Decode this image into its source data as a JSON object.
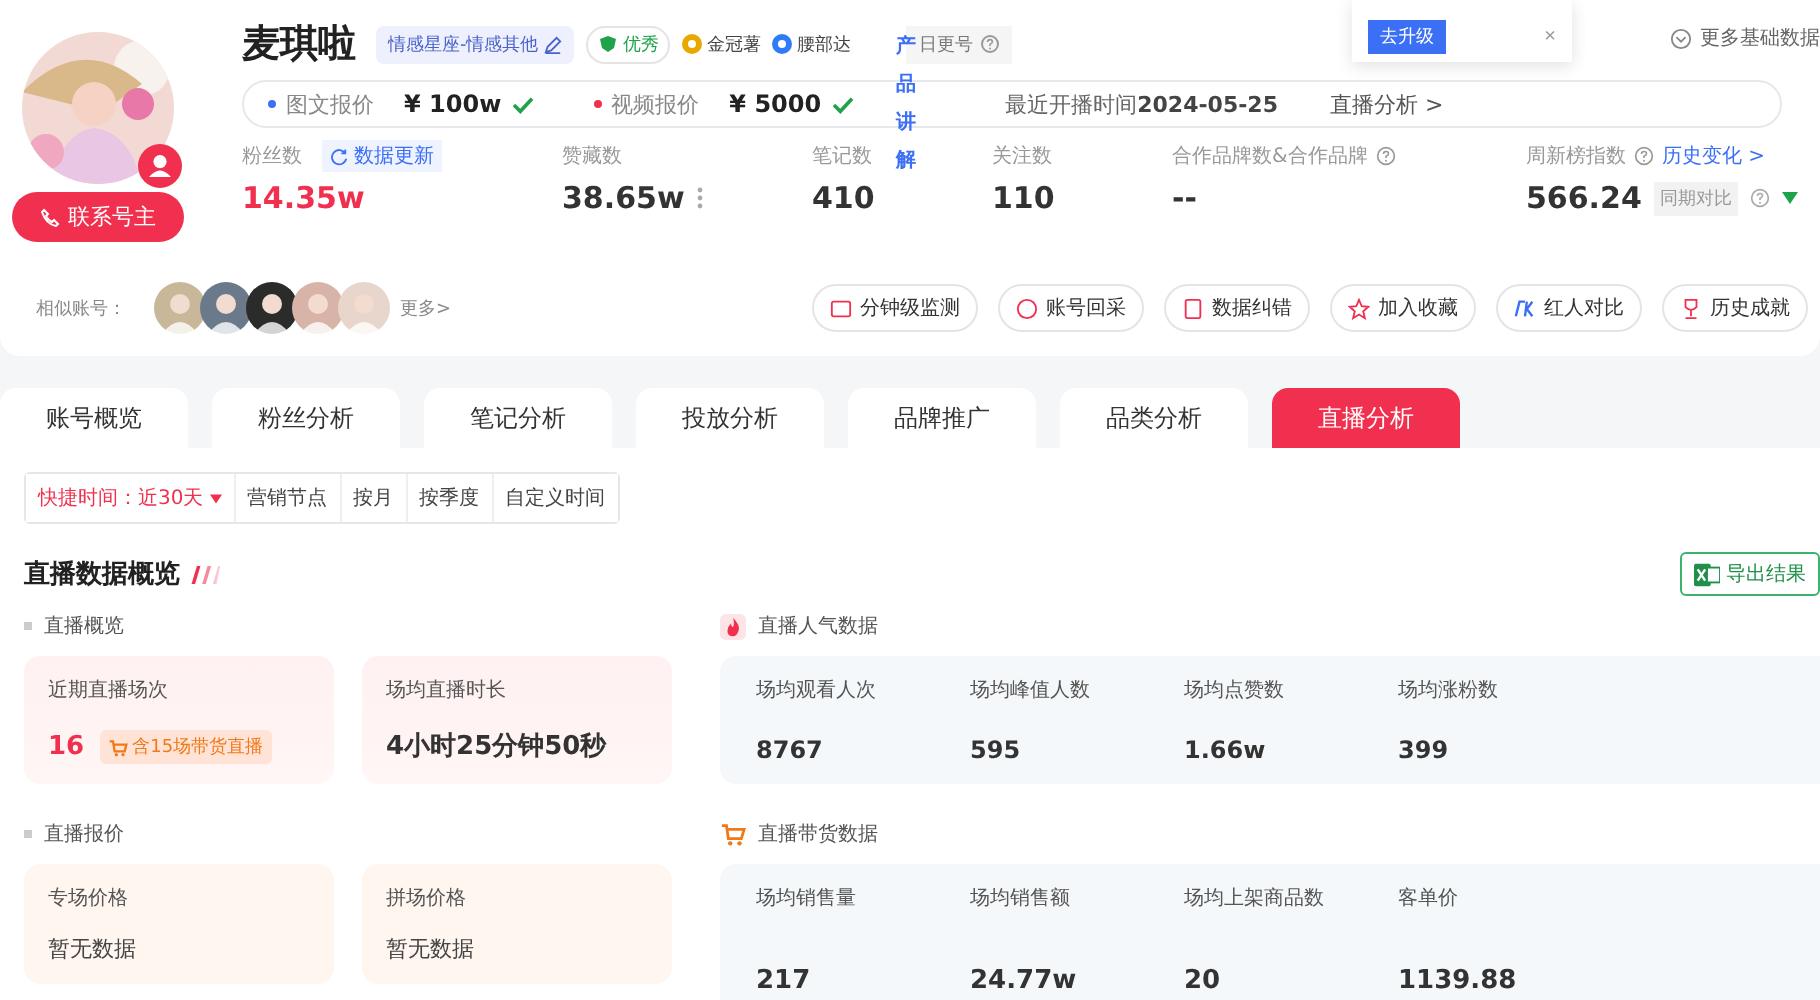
{
  "profile": {
    "name": "麦琪啦",
    "category": "情感星座-情感其他",
    "badges": [
      {
        "kind": "excellent",
        "label": "优秀"
      },
      {
        "kind": "crown",
        "label": "金冠薯"
      },
      {
        "kind": "brand",
        "label": "腰部达"
      },
      {
        "kind": "daily",
        "label": "日更号"
      }
    ],
    "contact_button": "联系号主",
    "prices": [
      {
        "label": "图文报价",
        "value": "¥ 100w",
        "verified": true,
        "color": "#3b6ff5"
      },
      {
        "label": "视频报价",
        "value": "¥ 5000",
        "verified": true,
        "color": "#f0304e"
      }
    ],
    "last_live_label": "最近开播时间",
    "last_live_date": "2024-05-25",
    "live_link": "直播分析 >",
    "side_label": "产品讲解",
    "popup": {
      "button": "去升级",
      "close": "×"
    },
    "more_data": "更多基础数据",
    "stats": [
      {
        "kind": "fans",
        "label": "粉丝数",
        "value": "14.35w",
        "link": "数据更新"
      },
      {
        "kind": "more",
        "label": "赞藏数",
        "value": "38.65w"
      },
      {
        "kind": "plain",
        "label": "笔记数",
        "value": "410"
      },
      {
        "kind": "plain",
        "label": "关注数",
        "value": "110"
      },
      {
        "kind": "help",
        "label": "合作品牌数&合作品牌",
        "value": "--"
      },
      {
        "kind": "index",
        "label": "周新榜指数",
        "value": "566.24",
        "link": "历史变化 >",
        "compare": "同期对比"
      }
    ]
  },
  "similar": {
    "label": "相似账号：",
    "more": "更多>",
    "actions": [
      {
        "kind": "monitor",
        "label": "分钟级监测"
      },
      {
        "kind": "collect",
        "label": "账号回采"
      },
      {
        "kind": "report",
        "label": "数据纠错"
      },
      {
        "kind": "favorite",
        "label": "加入收藏"
      },
      {
        "kind": "pk",
        "label": "红人对比"
      },
      {
        "kind": "award",
        "label": "历史成就"
      }
    ]
  },
  "tabs": [
    {
      "label": "账号概览",
      "selected": false
    },
    {
      "label": "粉丝分析",
      "selected": false
    },
    {
      "label": "笔记分析",
      "selected": false
    },
    {
      "label": "投放分析",
      "selected": false
    },
    {
      "label": "品牌推广",
      "selected": false
    },
    {
      "label": "品类分析",
      "selected": false
    },
    {
      "label": "直播分析",
      "selected": true
    }
  ],
  "filters": [
    {
      "label": "快捷时间：近30天",
      "selected": true,
      "dropdown": true
    },
    {
      "label": "营销节点",
      "selected": false,
      "dropdown": false
    },
    {
      "label": "按月",
      "selected": false,
      "dropdown": false
    },
    {
      "label": "按季度",
      "selected": false,
      "dropdown": false
    },
    {
      "label": "自定义时间",
      "selected": false,
      "dropdown": false
    }
  ],
  "section_title": "直播数据概览",
  "export_button": "导出结果",
  "live_overview": {
    "title": "直播概览",
    "cards": [
      {
        "label": "近期直播场次",
        "value": "16",
        "note": "含15场带货直播"
      },
      {
        "label": "场均直播时长",
        "value": "4小时25分钟50秒"
      }
    ]
  },
  "popularity": {
    "title": "直播人气数据",
    "metrics": [
      {
        "label": "场均观看人次",
        "value": "8767"
      },
      {
        "label": "场均峰值人数",
        "value": "595"
      },
      {
        "label": "场均点赞数",
        "value": "1.66w"
      },
      {
        "label": "场均涨粉数",
        "value": "399"
      }
    ]
  },
  "live_price": {
    "title": "直播报价",
    "cards": [
      {
        "label": "专场价格",
        "value": "暂无数据"
      },
      {
        "label": "拼场价格",
        "value": "暂无数据"
      }
    ]
  },
  "sales": {
    "title": "直播带货数据",
    "metrics": [
      {
        "label": "场均销售量",
        "value": "217"
      },
      {
        "label": "场均销售额",
        "value": "24.77w"
      },
      {
        "label": "场均上架商品数",
        "value": "20"
      },
      {
        "label": "客单价",
        "value": "1139.88"
      }
    ]
  }
}
